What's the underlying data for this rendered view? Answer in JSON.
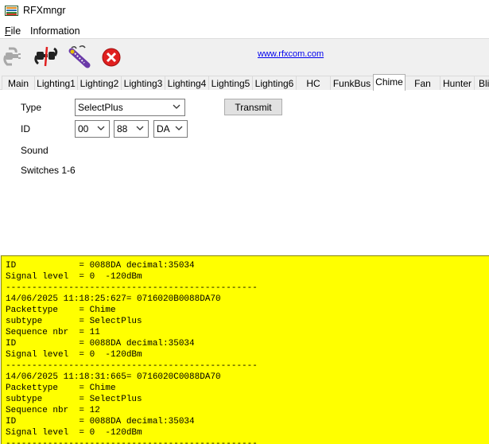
{
  "window": {
    "title": "RFXmngr"
  },
  "menu": {
    "items": [
      {
        "key": "F",
        "rest": "ile"
      },
      {
        "key": "",
        "rest": "Information"
      }
    ]
  },
  "toolbar": {
    "icons": [
      "connect-plug-icon",
      "disconnect-icon",
      "receiver-wand-icon",
      "close-red-x-icon"
    ],
    "link": "www.rfxcom.com"
  },
  "tabs": [
    "Main",
    "Lighting1",
    "Lighting2",
    "Lighting3",
    "Lighting4",
    "Lighting5",
    "Lighting6",
    "HC",
    "FunkBus",
    "Chime",
    "Fan",
    "Hunter",
    "Blin"
  ],
  "active_tab": "Chime",
  "form": {
    "type_label": "Type",
    "type_value": "SelectPlus",
    "id_label": "ID",
    "id_values": [
      "00",
      "88",
      "DA"
    ],
    "sound_label": "Sound",
    "switches_label": "Switches 1-6",
    "transmit_label": "Transmit"
  },
  "log": [
    "ID            = 0088DA decimal:35034",
    "Signal level  = 0  -120dBm",
    "------------------------------------------------",
    "14/06/2025 11:18:25:627= 0716020B0088DA70",
    "Packettype    = Chime",
    "subtype       = SelectPlus",
    "Sequence nbr  = 11",
    "ID            = 0088DA decimal:35034",
    "Signal level  = 0  -120dBm",
    "------------------------------------------------",
    "14/06/2025 11:18:31:665= 0716020C0088DA70",
    "Packettype    = Chime",
    "subtype       = SelectPlus",
    "Sequence nbr  = 12",
    "ID            = 0088DA decimal:35034",
    "Signal level  = 0  -120dBm",
    "------------------------------------------------"
  ],
  "colors": {
    "log_background": "#ffff00",
    "link": "#0000ee"
  }
}
